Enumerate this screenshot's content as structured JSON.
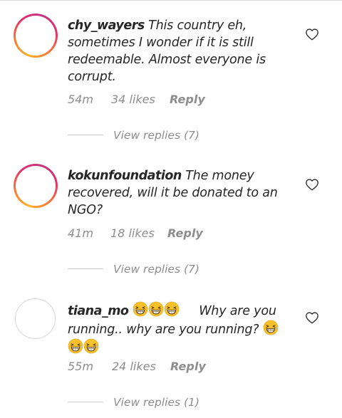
{
  "comments": [
    {
      "username": "chy_wayers",
      "text_line1": " This country eh,",
      "text_line2": "sometimes I wonder if it is still",
      "text_line3": "redeemable. Almost everyone is",
      "text_line4": "corrupt.",
      "time": "54m",
      "likes": "34 likes",
      "reply": "Reply",
      "view_replies": "View replies (7)",
      "avatar_style": "story-ring"
    },
    {
      "username": "kokunfoundation",
      "text_line1": " The money",
      "text_line2": "recovered, will it be donated to an",
      "text_line3": "NGO?",
      "time": "41m",
      "likes": "18 likes",
      "reply": "Reply",
      "view_replies": "View replies (7)",
      "avatar_style": "story-ring"
    },
    {
      "username": "tiana_mo",
      "text_line1": "Why are you",
      "text_line2": "running.. why are you running?",
      "time": "55m",
      "likes": "24 likes",
      "reply": "Reply",
      "view_replies": "View replies (1)",
      "avatar_style": "plain",
      "emoji": "grinning-squinting-face"
    }
  ],
  "icons": {
    "like": "heart-outline-icon",
    "emoji": "grinning-squinting-face-emoji"
  },
  "colors": {
    "text": "#262626",
    "secondary": "#8e8e8e",
    "story_ring_start": "#f9b12a",
    "story_ring_end": "#c13584",
    "emoji_face": "#f7c12c"
  }
}
